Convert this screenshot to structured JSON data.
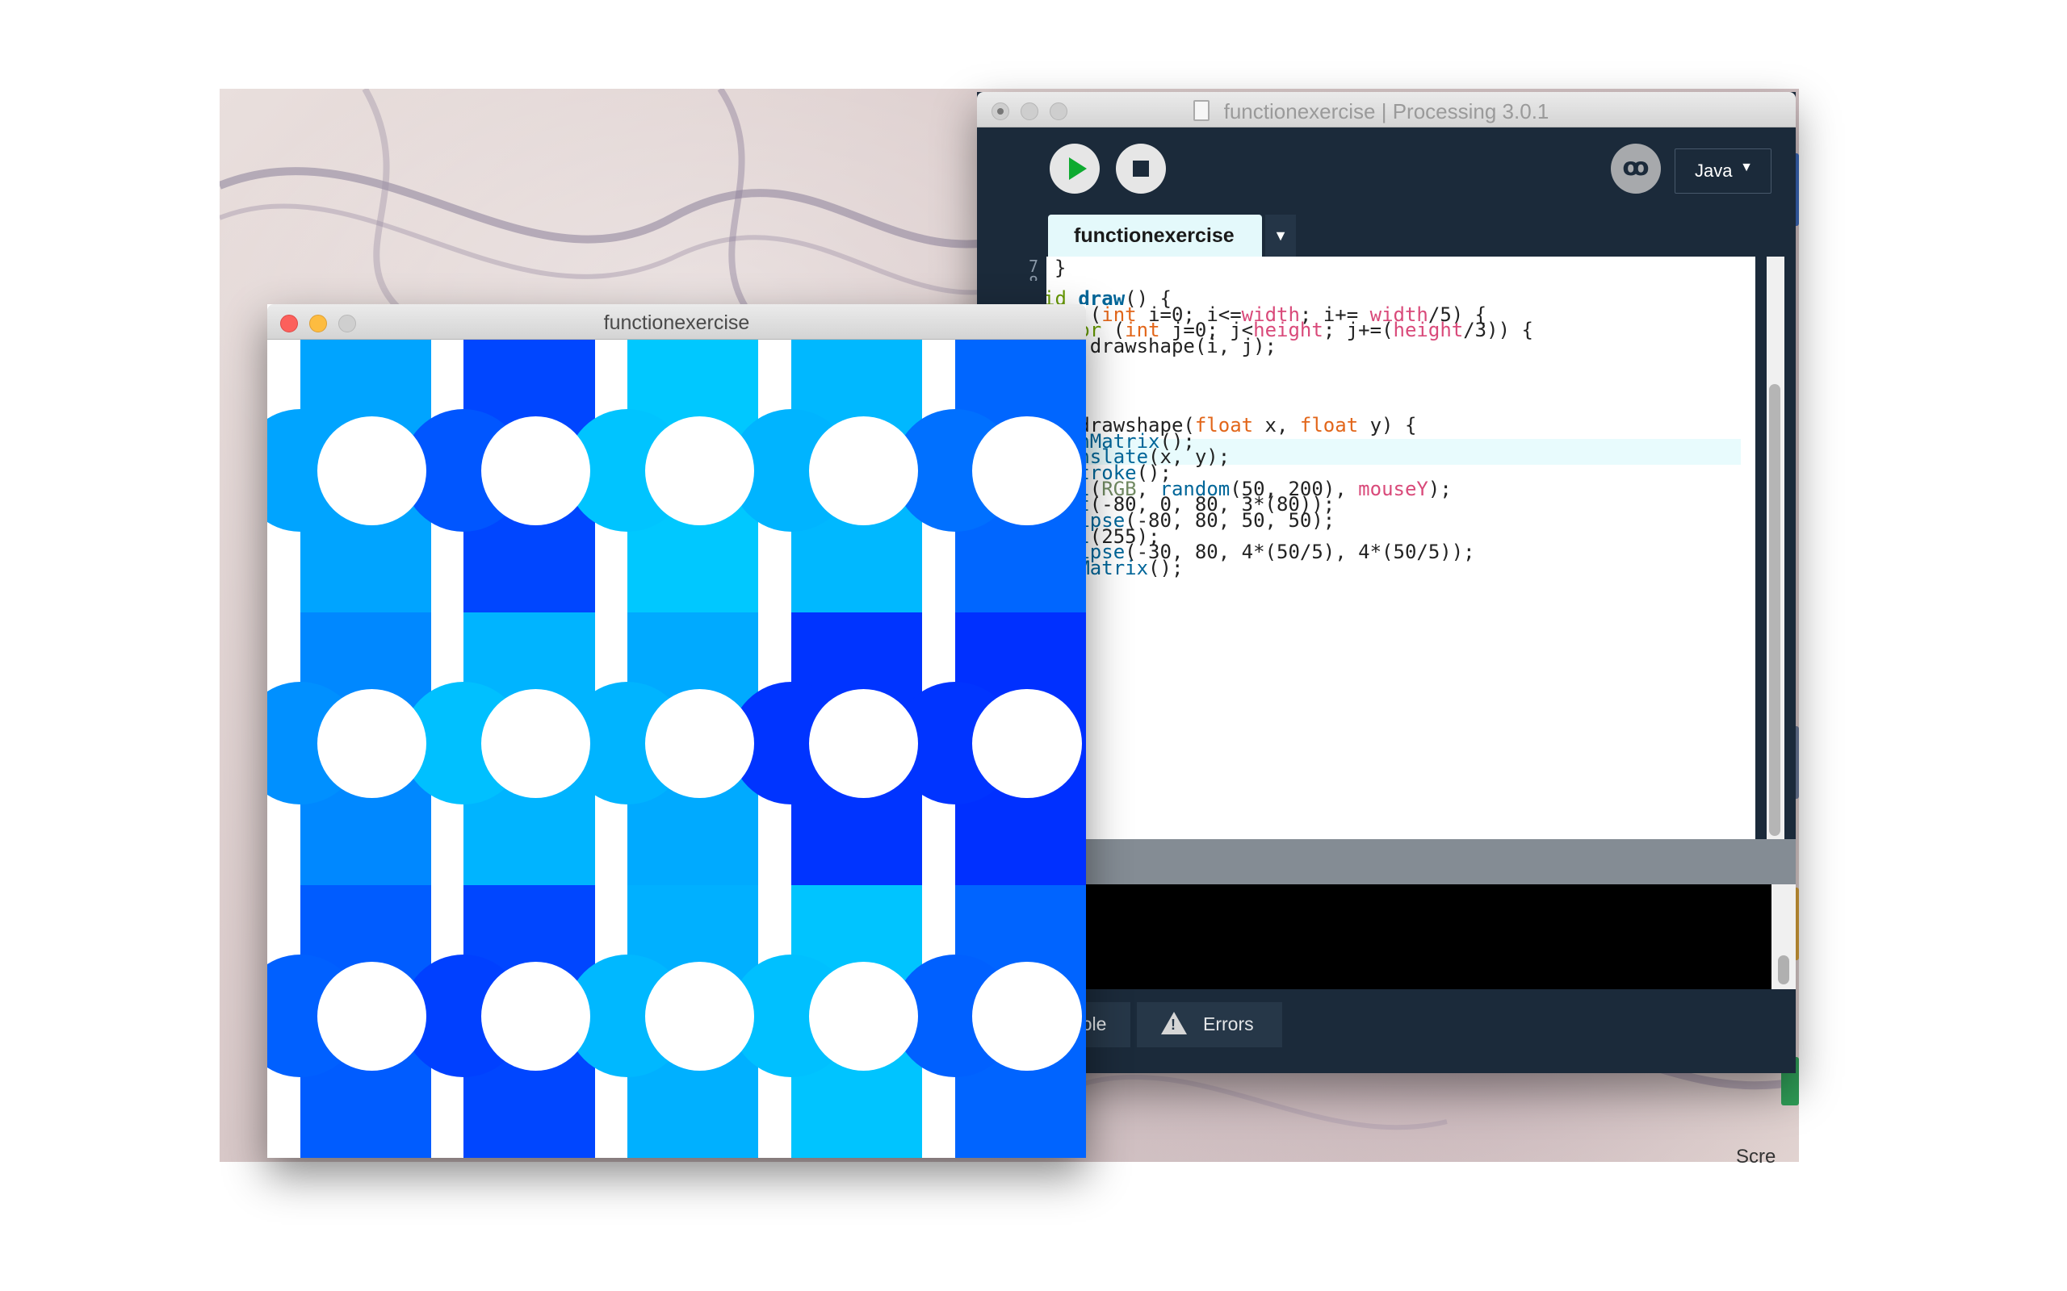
{
  "desktop": {
    "partial_label": "Scre"
  },
  "sketch_window": {
    "title": "functionexercise",
    "columns": 5,
    "rows": 3,
    "cells": [
      [
        "#00a4ff",
        "#0046ff",
        "#00c8ff",
        "#00b8ff",
        "#0066ff"
      ],
      [
        "#0088ff",
        "#00b4ff",
        "#00aaff",
        "#0034ff",
        "#0030ff"
      ],
      [
        "#005cff",
        "#0046ff",
        "#00b0ff",
        "#00c4ff",
        "#0064ff"
      ]
    ],
    "dot_colors": [
      [
        "#00a4ff",
        "#0056ff",
        "#00c4ff",
        "#00b4ff",
        "#0070ff"
      ],
      [
        "#0090ff",
        "#00c0ff",
        "#00b4ff",
        "#0034ff",
        "#0034ff"
      ],
      [
        "#0060ff",
        "#0040ff",
        "#00b8ff",
        "#00c0ff",
        "#0060ff"
      ]
    ]
  },
  "ide_window": {
    "title": "functionexercise | Processing 3.0.1",
    "mode": "Java",
    "mode_arrow": "▼",
    "tab_label": "functionexercise",
    "tab_menu_arrow": "▼",
    "debug_glyph": "ꝏ",
    "line_numbers": [
      "7",
      "8"
    ],
    "code": [
      "}",
      "",
      "id draw() {",
      "for (int i=0; i<=width; i+= width/5) {",
      "  for (int j=0; j<height; j+=(height/3)) {",
      "    drawshape(i, j);",
      "  }",
      "}",
      "",
      "",
      "id drawshape(float x, float y) {",
      "pushMatrix();",
      "translate(x, y);",
      "noStroke();",
      "fill(RGB, random(50, 200), mouseY);",
      "rect(-80, 0, 80, 3*(80));",
      "ellipse(-80, 80, 50, 50);",
      "fill(255);",
      "ellipse(-30, 80, 4*(50/5), 4*(50/5));",
      "popMatrix();"
    ],
    "footer_tabs": [
      "Console",
      "Errors"
    ]
  }
}
